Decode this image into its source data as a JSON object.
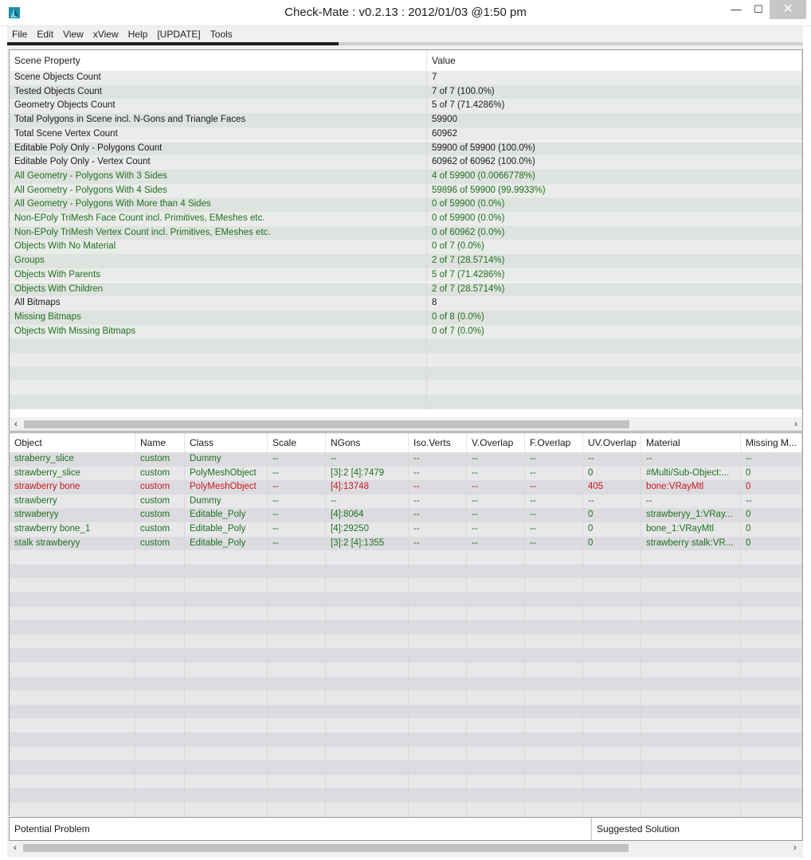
{
  "window": {
    "title": "Check-Mate : v0.2.13 : 2012/01/03 @1:50 pm",
    "minimize": "—",
    "maximize": "☐",
    "close": "✕"
  },
  "menu": [
    "File",
    "Edit",
    "View",
    "xView",
    "Help",
    "[UPDATE]",
    "Tools"
  ],
  "scene_table": {
    "headers": [
      "Scene Property",
      "Value"
    ],
    "rows": [
      {
        "property": "Scene Objects Count",
        "value": "7",
        "color": "black"
      },
      {
        "property": "Tested Objects Count",
        "value": "7 of 7 (100.0%)",
        "color": "black"
      },
      {
        "property": "Geometry Objects Count",
        "value": "5 of 7 (71.4286%)",
        "color": "black"
      },
      {
        "property": "Total Polygons in Scene incl. N-Gons and Triangle Faces",
        "value": "59900",
        "color": "black"
      },
      {
        "property": "Total Scene Vertex Count",
        "value": "60962",
        "color": "black"
      },
      {
        "property": "Editable Poly Only - Polygons Count",
        "value": "59900 of 59900 (100.0%)",
        "color": "black"
      },
      {
        "property": "Editable Poly Only - Vertex Count",
        "value": "60962 of 60962 (100.0%)",
        "color": "black"
      },
      {
        "property": "All Geometry - Polygons With 3 Sides",
        "value": "4 of 59900 (0.0066778%)",
        "color": "green"
      },
      {
        "property": "All Geometry - Polygons With 4 Sides",
        "value": "59896 of 59900 (99.9933%)",
        "color": "green"
      },
      {
        "property": "All Geometry - Polygons With More than 4 Sides",
        "value": "0 of 59900 (0.0%)",
        "color": "green"
      },
      {
        "property": "Non-EPoly TriMesh Face Count incl. Primitives, EMeshes etc.",
        "value": "0 of 59900 (0.0%)",
        "color": "green"
      },
      {
        "property": "Non-EPoly TriMesh Vertex Count incl. Primitives, EMeshes etc.",
        "value": "0 of 60962 (0.0%)",
        "color": "green"
      },
      {
        "property": "Objects With No Material",
        "value": "0 of 7 (0.0%)",
        "color": "green"
      },
      {
        "property": "Groups",
        "value": "2 of 7 (28.5714%)",
        "color": "green"
      },
      {
        "property": "Objects With Parents",
        "value": "5 of 7 (71.4286%)",
        "color": "green"
      },
      {
        "property": "Objects With Children",
        "value": "2 of 7 (28.5714%)",
        "color": "green"
      },
      {
        "property": "All Bitmaps",
        "value": "8",
        "color": "black"
      },
      {
        "property": "Missing Bitmaps",
        "value": "0 of 8 (0.0%)",
        "color": "green"
      },
      {
        "property": "Objects With Missing Bitmaps",
        "value": "0 of 7 (0.0%)",
        "color": "green"
      }
    ]
  },
  "object_table": {
    "headers": [
      "Object",
      "Name",
      "Class",
      "Scale",
      "NGons",
      "Iso.Verts",
      "V.Overlap",
      "F.Overlap",
      "UV.Overlap",
      "Material",
      "Missing M..."
    ],
    "rows": [
      {
        "color": "green",
        "cells": [
          "straberry_slice",
          "custom",
          "Dummy",
          "--",
          "--",
          "--",
          "--",
          "--",
          "--",
          "--",
          "--"
        ]
      },
      {
        "color": "green",
        "cells": [
          "strawberry_slice",
          "custom",
          "PolyMeshObject",
          "--",
          "[3]:2 [4]:7479",
          "--",
          "--",
          "--",
          "0",
          "#Multi/Sub-Object:...",
          "0"
        ]
      },
      {
        "color": "red",
        "cells": [
          "strawberry bone",
          "custom",
          "PolyMeshObject",
          "--",
          "[4]:13748",
          "--",
          "--",
          "--",
          "405",
          "bone:VRayMtl",
          "0"
        ]
      },
      {
        "color": "green",
        "cells": [
          "strawberry",
          "custom",
          "Dummy",
          "--",
          "--",
          "--",
          "--",
          "--",
          "--",
          "--",
          "--"
        ]
      },
      {
        "color": "green",
        "cells": [
          "strwaberyy",
          "custom",
          "Editable_Poly",
          "--",
          "[4]:8064",
          "--",
          "--",
          "--",
          "0",
          "strawberyy_1:VRay...",
          "0"
        ]
      },
      {
        "color": "green",
        "cells": [
          "strawberry bone_1",
          "custom",
          "Editable_Poly",
          "--",
          "[4]:29250",
          "--",
          "--",
          "--",
          "0",
          "bone_1:VRayMtl",
          "0"
        ]
      },
      {
        "color": "green",
        "cells": [
          "stalk strawberyy",
          "custom",
          "Editable_Poly",
          "--",
          "[3]:2 [4]:1355",
          "--",
          "--",
          "--",
          "0",
          "strawberry stalk:VR...",
          "0"
        ]
      }
    ]
  },
  "problem_table": {
    "headers": [
      "Potential Problem",
      "Suggested Solution"
    ]
  },
  "scroll": {
    "left": "‹",
    "right": "›"
  },
  "colors": {
    "green": "#1f6f1f",
    "red": "#c8181f",
    "black": "#1a1a1a"
  }
}
